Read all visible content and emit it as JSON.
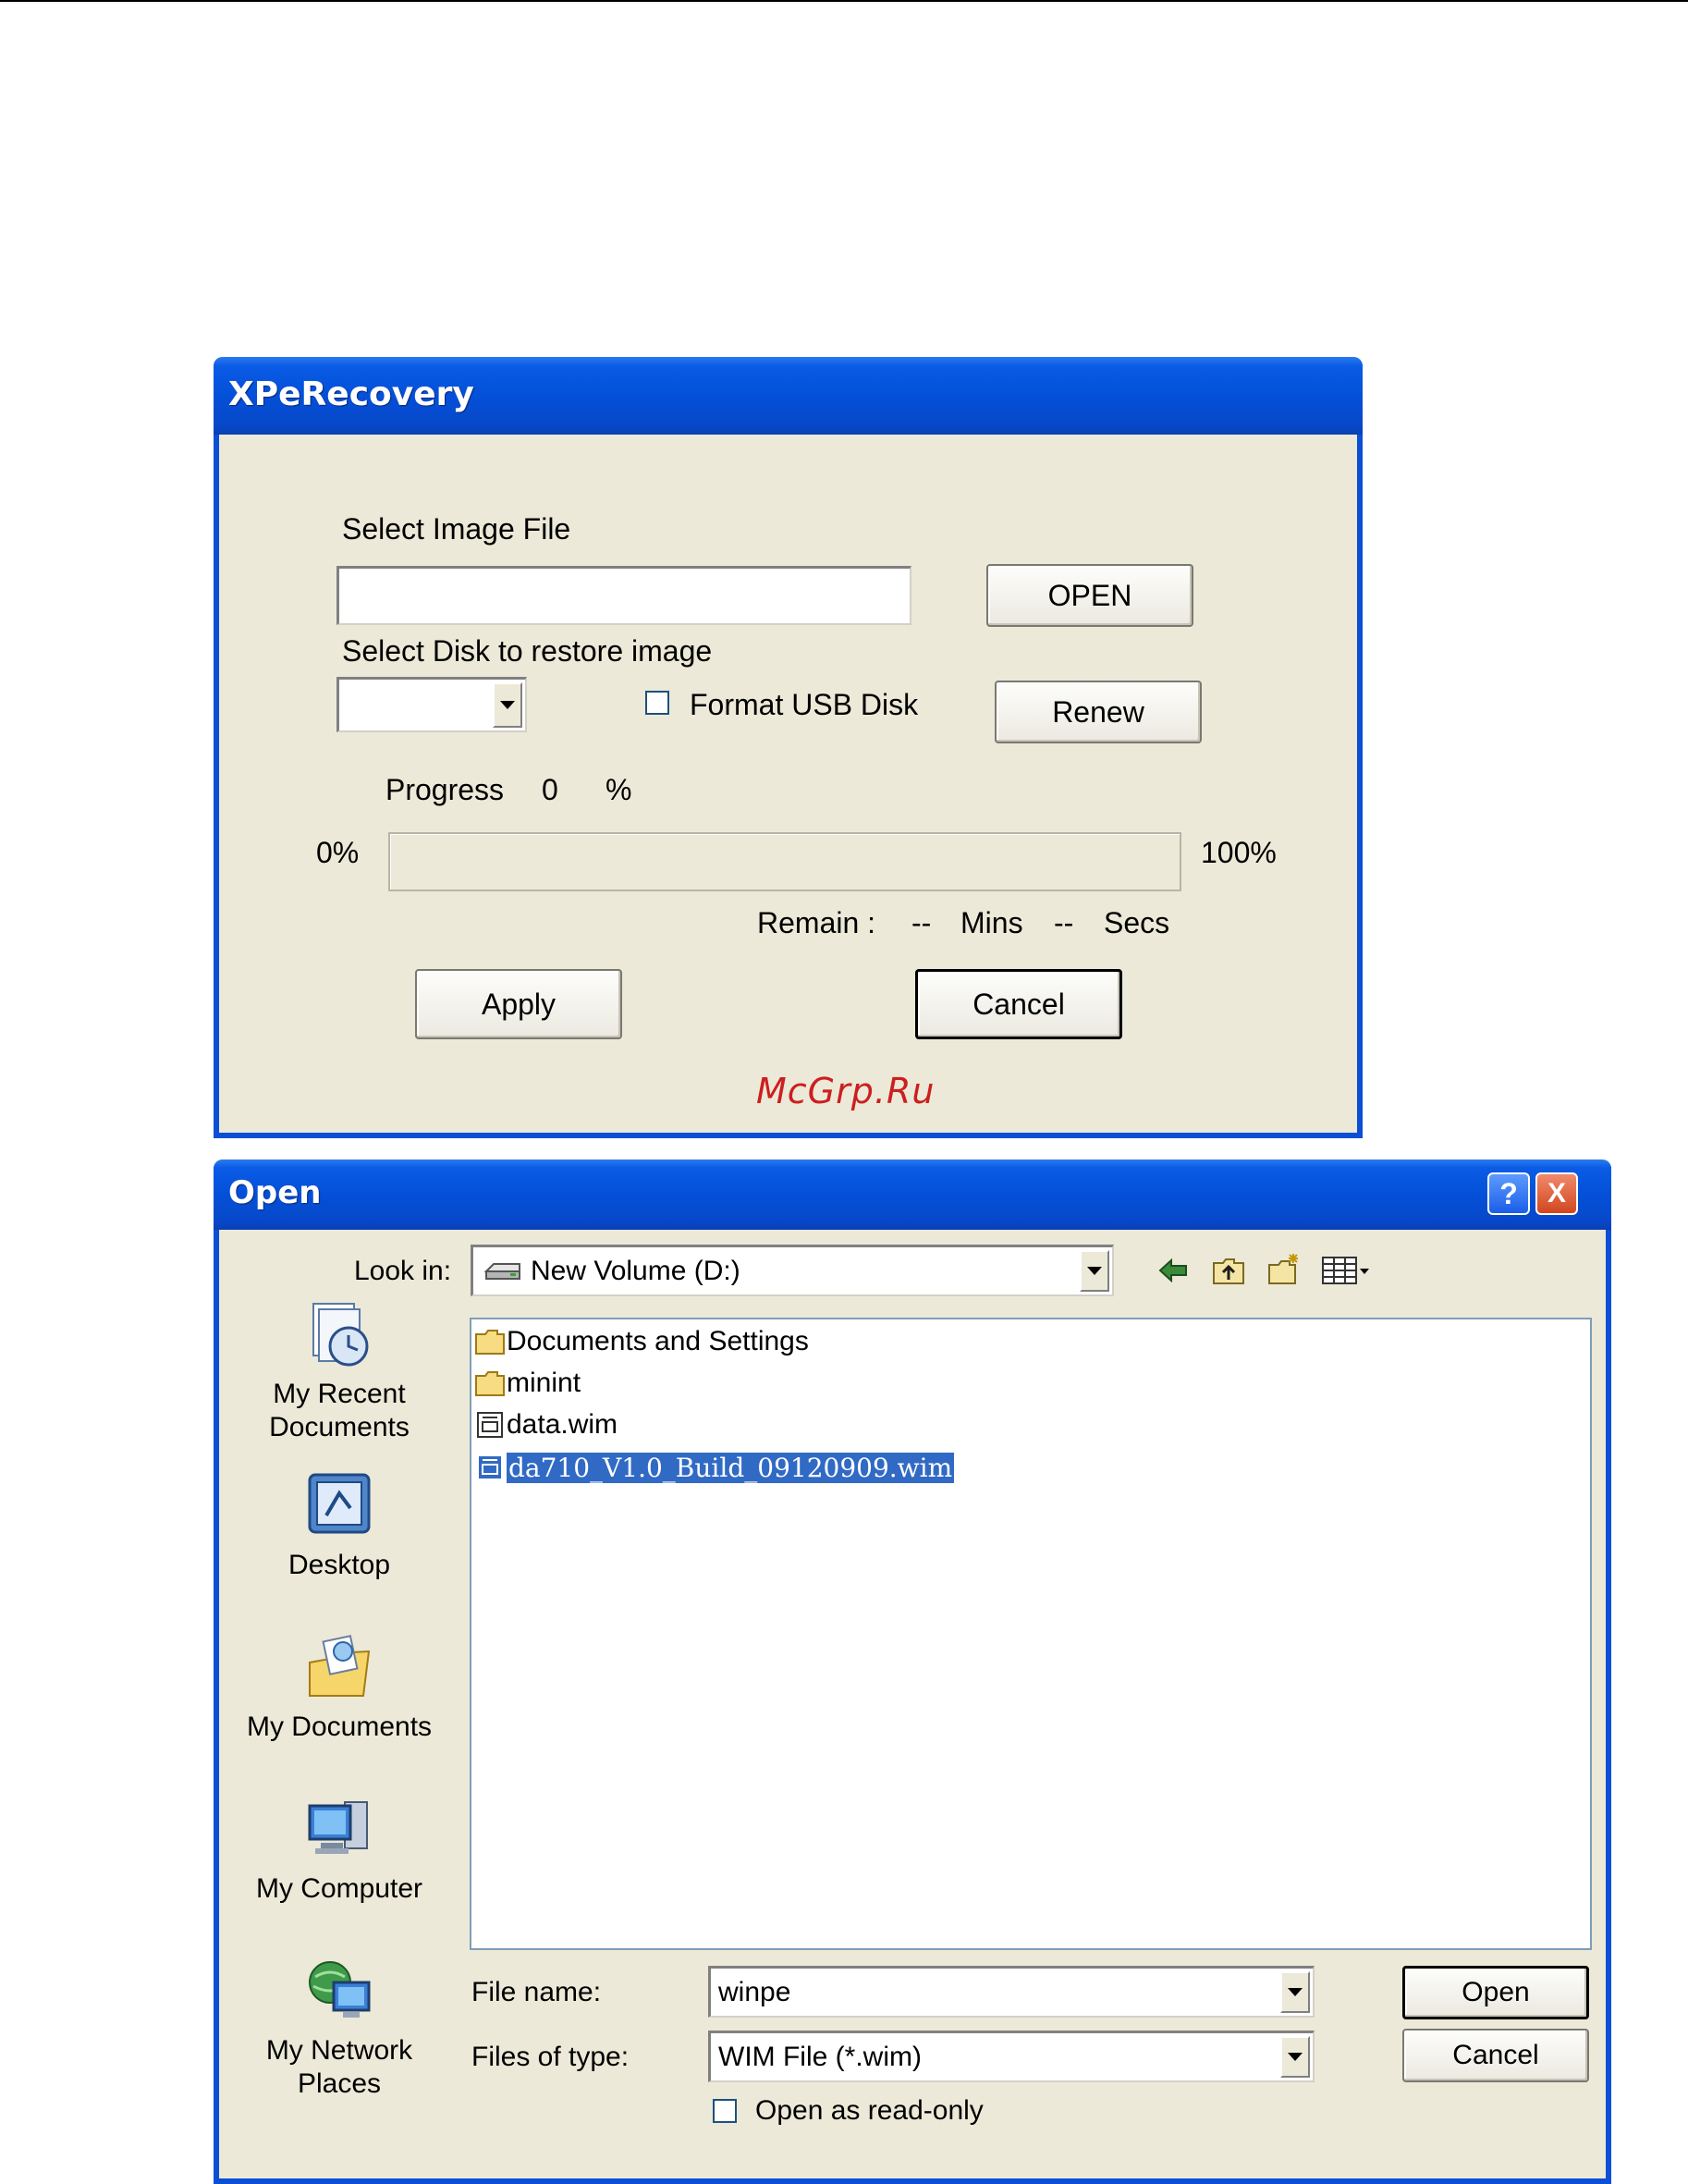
{
  "recovery": {
    "title": "XPeRecovery",
    "select_image_label": "Select Image File",
    "image_path_value": "",
    "open_button": "OPEN",
    "select_disk_label": "Select Disk to restore image",
    "disk_value": "",
    "format_usb_label": "Format USB Disk",
    "format_usb_checked": false,
    "renew_button": "Renew",
    "progress_label": "Progress",
    "progress_value": "0",
    "progress_unit": "%",
    "progress_fraction": 0,
    "range_min": "0%",
    "range_max": "100%",
    "remain_label": "Remain :",
    "remain_mins": "--",
    "mins_label": "Mins",
    "remain_secs": "--",
    "secs_label": "Secs",
    "apply_button": "Apply",
    "cancel_button": "Cancel"
  },
  "watermark": "McGrp.Ru",
  "open_dialog": {
    "title": "Open",
    "help_glyph": "?",
    "close_glyph": "X",
    "look_in_label": "Look in:",
    "look_in_value": "New Volume (D:)",
    "places": [
      {
        "label": "My Recent Documents",
        "icon": "recent-documents-icon"
      },
      {
        "label": "Desktop",
        "icon": "desktop-icon"
      },
      {
        "label": "My Documents",
        "icon": "my-documents-icon"
      },
      {
        "label": "My Computer",
        "icon": "my-computer-icon"
      },
      {
        "label": "My Network Places",
        "icon": "network-places-icon"
      }
    ],
    "files": [
      {
        "name": "Documents and Settings",
        "type": "folder"
      },
      {
        "name": "minint",
        "type": "folder"
      },
      {
        "name": "data.wim",
        "type": "wim"
      },
      {
        "name": "da710_V1.0_Build_09120909.wim",
        "type": "wim",
        "selected": true
      }
    ],
    "file_name_label": "File name:",
    "file_name_value": "winpe",
    "files_of_type_label": "Files of type:",
    "files_of_type_value": "WIM File (*.wim)",
    "read_only_label": "Open as read-only",
    "read_only_checked": false,
    "open_button": "Open",
    "cancel_button": "Cancel"
  }
}
